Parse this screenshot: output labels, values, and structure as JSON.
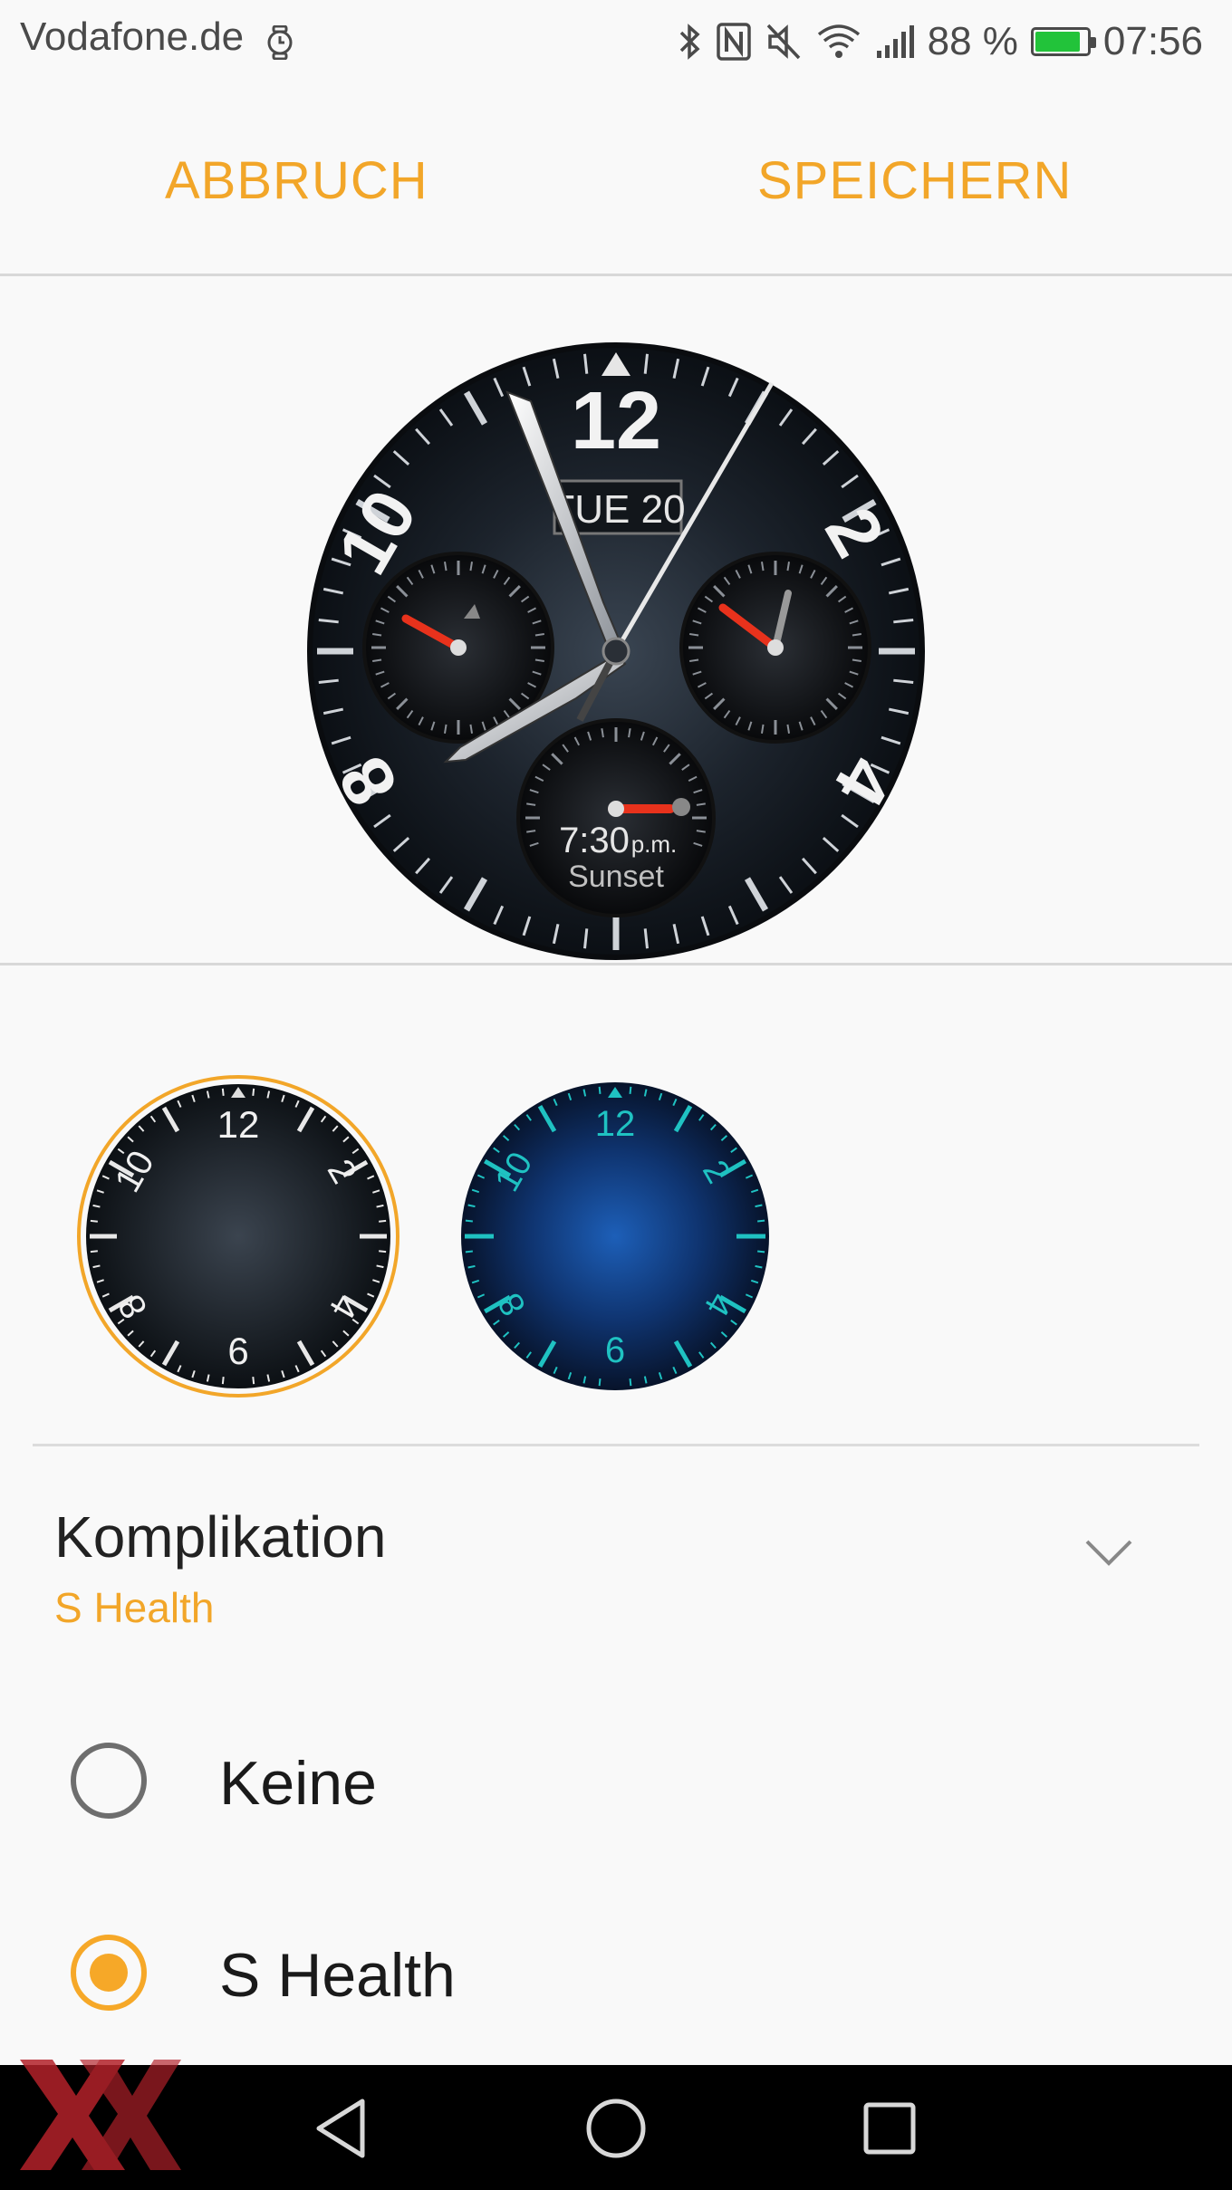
{
  "status_bar": {
    "carrier": "Vodafone.de",
    "battery_percent": "88 %",
    "battery_level": 0.88,
    "time": "07:56",
    "icons": [
      "watch-icon",
      "bluetooth-icon",
      "nfc-icon",
      "mute-icon",
      "wifi-icon",
      "signal-icon",
      "battery-charging-icon"
    ]
  },
  "actions": {
    "cancel_label": "ABBRUCH",
    "save_label": "SPEICHERN"
  },
  "preview": {
    "date_label": "TUE 20",
    "numerals": [
      "12",
      "2",
      "4",
      "8",
      "10"
    ],
    "sunset_time": "7:30",
    "sunset_suffix": "p.m.",
    "sunset_label": "Sunset"
  },
  "thumbnails": [
    {
      "name": "black",
      "numerals": [
        "12",
        "2",
        "4",
        "6",
        "8",
        "10"
      ],
      "selected": true
    },
    {
      "name": "blue",
      "numerals": [
        "12",
        "2",
        "4",
        "6",
        "8",
        "10"
      ],
      "selected": false
    }
  ],
  "complication": {
    "title": "Komplikation",
    "value": "S Health",
    "options": [
      {
        "label": "Keine",
        "selected": false
      },
      {
        "label": "S Health",
        "selected": true
      }
    ]
  },
  "colors": {
    "accent": "#f2a629",
    "teal": "#1fc2c2",
    "battery": "#22c33a"
  }
}
